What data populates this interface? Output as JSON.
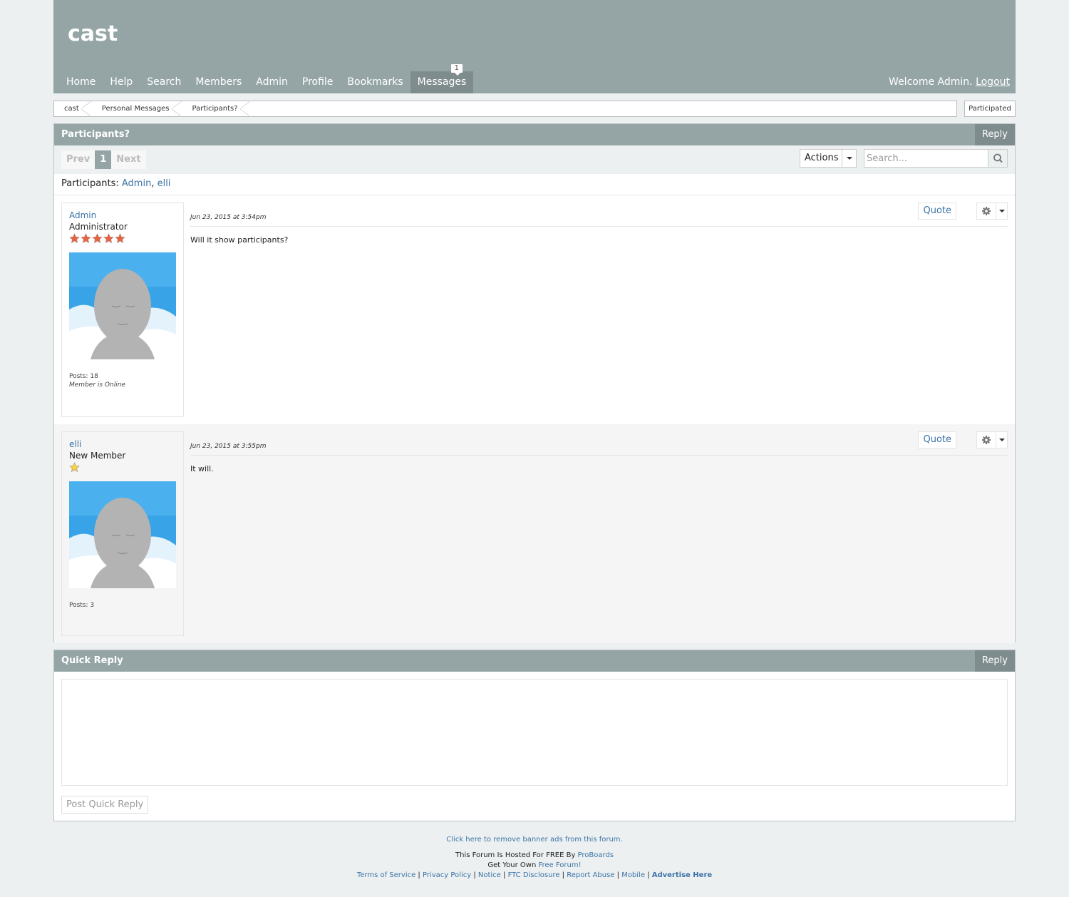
{
  "site": {
    "title": "cast"
  },
  "nav": {
    "items": [
      "Home",
      "Help",
      "Search",
      "Members",
      "Admin",
      "Profile",
      "Bookmarks",
      "Messages"
    ],
    "messages_badge": "1",
    "welcome_text": "Welcome Admin. ",
    "logout": "Logout"
  },
  "breadcrumb": {
    "items": [
      "cast",
      "Personal Messages",
      "Participants?"
    ],
    "participated": "Participated"
  },
  "thread": {
    "title": "Participants?",
    "reply": "Reply",
    "pagination": {
      "prev": "Prev",
      "current": "1",
      "next": "Next"
    },
    "actions": "Actions",
    "search_placeholder": "Search...",
    "participants_label": "Participants: ",
    "participants": [
      "Admin",
      "elli"
    ],
    "participants_sep": ", "
  },
  "posts": [
    {
      "user": "Admin",
      "rank": "Administrator",
      "stars": 5,
      "star_color": "#e8623c",
      "posts": "Posts: 18",
      "status": "Member is Online",
      "date": "Jun 23, 2015 at 3:54pm",
      "body": "Will it show participants?",
      "quote": "Quote"
    },
    {
      "user": "elli",
      "rank": "New Member",
      "stars": 1,
      "star_color": "#f5d547",
      "posts": "Posts: 3",
      "date": "Jun 23, 2015 at 3:55pm",
      "body": "It will.",
      "quote": "Quote"
    }
  ],
  "quick_reply": {
    "title": "Quick Reply",
    "reply": "Reply",
    "submit": "Post Quick Reply"
  },
  "footer": {
    "remove_ads": "Click here to remove banner ads from this forum.",
    "hosted_prefix": "This Forum Is Hosted For FREE By ",
    "hosted_link": "ProBoards",
    "own_prefix": "Get Your Own ",
    "own_link": "Free Forum!",
    "links": [
      "Terms of Service",
      "Privacy Policy",
      "Notice",
      "FTC Disclosure",
      "Report Abuse",
      "Mobile"
    ],
    "advertise": "Advertise Here",
    "separator": " | "
  },
  "colors": {
    "header": "#95a5a6",
    "header_dark": "#7f8c8d",
    "link": "#3d73a6",
    "background": "#ecf0f1"
  }
}
